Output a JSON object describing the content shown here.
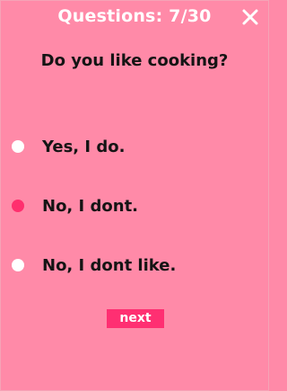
{
  "header": {
    "title": "Questions: 7/30",
    "close_icon": "close-icon"
  },
  "question": {
    "text": "Do you like cooking?"
  },
  "options": [
    {
      "label": "Yes, I do.",
      "selected": false
    },
    {
      "label": "No, I dont.",
      "selected": true
    },
    {
      "label": "No, I dont like.",
      "selected": false
    }
  ],
  "actions": {
    "next_label": "next"
  },
  "colors": {
    "background": "#ff8aa8",
    "accent": "#ff2f6e",
    "radio_unselected": "#ffffff",
    "text": "#141414",
    "header_text": "#ffffff"
  }
}
